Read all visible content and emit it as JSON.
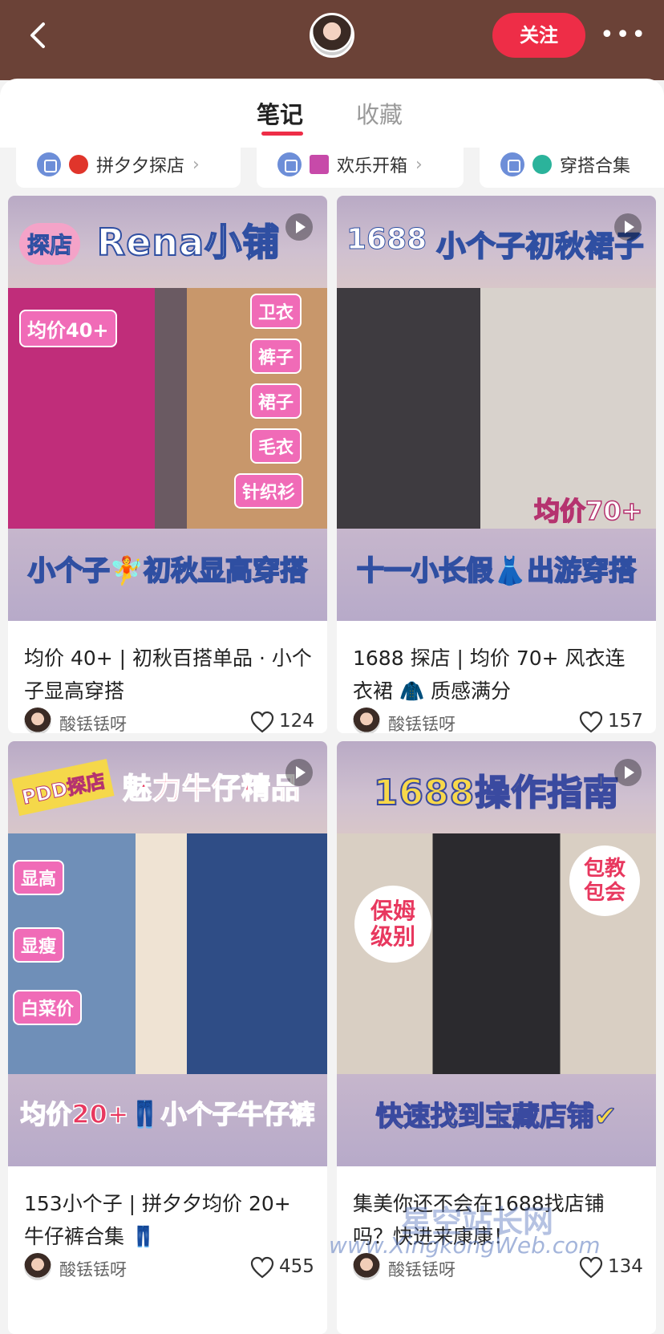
{
  "header": {
    "follow_label": "关注",
    "more_label": "•••"
  },
  "tabs": [
    {
      "label": "笔记",
      "active": true
    },
    {
      "label": "收藏",
      "active": false
    }
  ],
  "collections": [
    {
      "label": "拼夕夕探店"
    },
    {
      "label": "欢乐开箱"
    },
    {
      "label": "穿搭合集"
    }
  ],
  "notes": [
    {
      "cover_title": "Rena小铺",
      "cover_badge": "探店",
      "cover_tags": [
        "均价40+",
        "卫衣",
        "裤子",
        "裙子",
        "毛衣",
        "针织衫"
      ],
      "cover_footer": "小个子🧚初秋显高穿搭",
      "title": "均价 40+ | 初秋百搭单品 · 小个子显高穿搭",
      "author": "酸铥铥呀",
      "likes": "124"
    },
    {
      "cover_title": "小个子初秋裙子",
      "cover_badge": "1688",
      "cover_tags": [
        "均价70+"
      ],
      "cover_footer": "十一小长假👗出游穿搭",
      "title": "1688 探店 | 均价 70+ 风衣连衣裙 🧥 质感满分",
      "author": "酸铥铥呀",
      "likes": "157"
    },
    {
      "cover_title": "魅力牛仔精品",
      "cover_badge": "PDD探店",
      "cover_tags": [
        "显高",
        "显瘦",
        "白菜价"
      ],
      "cover_footer": "均价20+👖小个子牛仔裤",
      "title": "153小个子 | 拼夕夕均价 20+ 牛仔裤合集 👖",
      "author": "酸铥铥呀",
      "likes": "455"
    },
    {
      "cover_title": "1688操作指南",
      "cover_badge": "保姆级别",
      "cover_tags": [
        "包教包会"
      ],
      "cover_footer": "快速找到宝藏店铺✔",
      "title": "集美你还不会在1688找店铺吗？快进来康康！",
      "author": "酸铥铥呀",
      "likes": "134"
    }
  ],
  "watermark": {
    "site_cn": "星空站长网",
    "site_url": "www.XingkongWeb.com"
  }
}
